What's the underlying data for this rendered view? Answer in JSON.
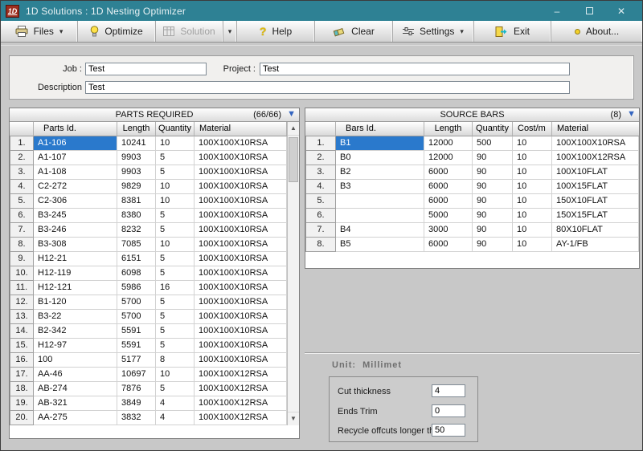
{
  "window": {
    "title": "1D Solutions : 1D Nesting Optimizer",
    "app_icon_text": "1D",
    "minimize": "–",
    "close": "✕"
  },
  "toolbar": {
    "files": "Files",
    "optimize": "Optimize",
    "solution": "Solution",
    "help": "Help",
    "clear": "Clear",
    "settings": "Settings",
    "exit": "Exit",
    "about": "About...",
    "dropdown": "▾",
    "help_glyph": "?"
  },
  "job_form": {
    "job_label": "Job :",
    "job_value": "Test",
    "project_label": "Project :",
    "project_value": "Test",
    "description_label": "Description",
    "description_value": "Test"
  },
  "parts_panel": {
    "title": "PARTS REQUIRED",
    "count": "(66/66)",
    "arrow": "▼",
    "columns": {
      "id": "Parts Id.",
      "length": "Length",
      "quantity": "Quantity",
      "material": "Material"
    },
    "scrollbar": {
      "up": "▲",
      "down": "▼"
    },
    "rows": [
      {
        "n": "1.",
        "id": "A1-106",
        "length": "10241",
        "quantity": "10",
        "material": "100X100X10RSA",
        "selected": true
      },
      {
        "n": "2.",
        "id": "A1-107",
        "length": "9903",
        "quantity": "5",
        "material": "100X100X10RSA"
      },
      {
        "n": "3.",
        "id": "A1-108",
        "length": "9903",
        "quantity": "5",
        "material": "100X100X10RSA"
      },
      {
        "n": "4.",
        "id": "C2-272",
        "length": "9829",
        "quantity": "10",
        "material": "100X100X10RSA"
      },
      {
        "n": "5.",
        "id": "C2-306",
        "length": "8381",
        "quantity": "10",
        "material": "100X100X10RSA"
      },
      {
        "n": "6.",
        "id": "B3-245",
        "length": "8380",
        "quantity": "5",
        "material": "100X100X10RSA"
      },
      {
        "n": "7.",
        "id": "B3-246",
        "length": "8232",
        "quantity": "5",
        "material": "100X100X10RSA"
      },
      {
        "n": "8.",
        "id": "B3-308",
        "length": "7085",
        "quantity": "10",
        "material": "100X100X10RSA"
      },
      {
        "n": "9.",
        "id": "H12-21",
        "length": "6151",
        "quantity": "5",
        "material": "100X100X10RSA"
      },
      {
        "n": "10.",
        "id": "H12-119",
        "length": "6098",
        "quantity": "5",
        "material": "100X100X10RSA"
      },
      {
        "n": "11.",
        "id": "H12-121",
        "length": "5986",
        "quantity": "16",
        "material": "100X100X10RSA"
      },
      {
        "n": "12.",
        "id": "B1-120",
        "length": "5700",
        "quantity": "5",
        "material": "100X100X10RSA"
      },
      {
        "n": "13.",
        "id": "B3-22",
        "length": "5700",
        "quantity": "5",
        "material": "100X100X10RSA"
      },
      {
        "n": "14.",
        "id": "B2-342",
        "length": "5591",
        "quantity": "5",
        "material": "100X100X10RSA"
      },
      {
        "n": "15.",
        "id": "H12-97",
        "length": "5591",
        "quantity": "5",
        "material": "100X100X10RSA"
      },
      {
        "n": "16.",
        "id": "100",
        "length": "5177",
        "quantity": "8",
        "material": "100X100X10RSA"
      },
      {
        "n": "17.",
        "id": "AA-46",
        "length": "10697",
        "quantity": "10",
        "material": "100X100X12RSA"
      },
      {
        "n": "18.",
        "id": "AB-274",
        "length": "7876",
        "quantity": "5",
        "material": "100X100X12RSA"
      },
      {
        "n": "19.",
        "id": "AB-321",
        "length": "3849",
        "quantity": "4",
        "material": "100X100X12RSA"
      },
      {
        "n": "20.",
        "id": "AA-275",
        "length": "3832",
        "quantity": "4",
        "material": "100X100X12RSA"
      }
    ]
  },
  "source_panel": {
    "title": "SOURCE BARS",
    "count": "(8)",
    "arrow": "▼",
    "columns": {
      "id": "Bars Id.",
      "length": "Length",
      "quantity": "Quantity",
      "cost": "Cost/m",
      "material": "Material"
    },
    "rows": [
      {
        "n": "1.",
        "id": "B1",
        "length": "12000",
        "quantity": "500",
        "cost": "10",
        "material": "100X100X10RSA",
        "selected": true
      },
      {
        "n": "2.",
        "id": "B0",
        "length": "12000",
        "quantity": "90",
        "cost": "10",
        "material": "100X100X12RSA"
      },
      {
        "n": "3.",
        "id": "B2",
        "length": "6000",
        "quantity": "90",
        "cost": "10",
        "material": "100X10FLAT"
      },
      {
        "n": "4.",
        "id": "B3",
        "length": "6000",
        "quantity": "90",
        "cost": "10",
        "material": "100X15FLAT"
      },
      {
        "n": "5.",
        "id": "",
        "length": "6000",
        "quantity": "90",
        "cost": "10",
        "material": "150X10FLAT"
      },
      {
        "n": "6.",
        "id": "",
        "length": "5000",
        "quantity": "90",
        "cost": "10",
        "material": "150X15FLAT"
      },
      {
        "n": "7.",
        "id": "B4",
        "length": "3000",
        "quantity": "90",
        "cost": "10",
        "material": "80X10FLAT"
      },
      {
        "n": "8.",
        "id": "B5",
        "length": "6000",
        "quantity": "90",
        "cost": "10",
        "material": "AY-1/FB"
      }
    ]
  },
  "unit_section": {
    "unit_label": "Unit: Millimet",
    "cut_thickness_label": "Cut thickness",
    "cut_thickness_value": "4",
    "ends_trim_label": "Ends Trim",
    "ends_trim_value": "0",
    "recycle_label": "Recycle offcuts longer than",
    "recycle_value": "50"
  },
  "icons": {
    "app_icon": "1d-logo",
    "files_icon": "printer",
    "optimize_icon": "lightbulb",
    "solution_icon": "grid",
    "help_icon": "question-mark",
    "clear_icon": "eraser",
    "settings_icon": "sliders",
    "exit_icon": "door-arrow",
    "about_icon": "yellow-dot"
  },
  "colors": {
    "titlebar": "#2e8194",
    "selection": "#2a79cc",
    "panel_arrow": "#3465c0",
    "app_icon_red": "#9c2e1e"
  }
}
